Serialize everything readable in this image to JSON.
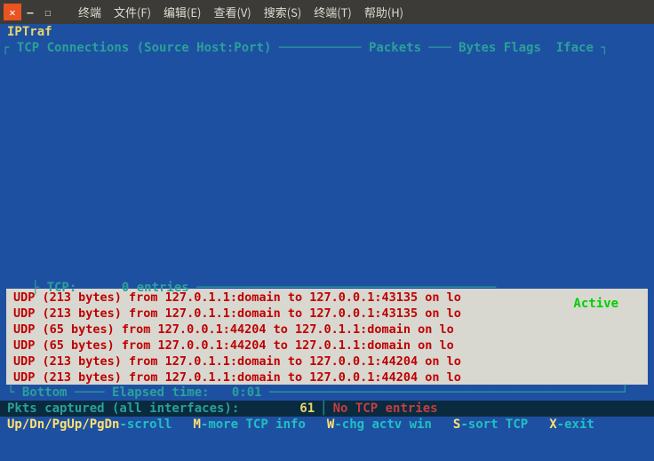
{
  "window": {
    "close": "✕",
    "min": "–",
    "max": "☐"
  },
  "menu": {
    "terminal_app": "终端",
    "file": "文件(F)",
    "edit": "编辑(E)",
    "view": "查看(V)",
    "search": "搜索(S)",
    "terminal": "终端(T)",
    "help": "帮助(H)"
  },
  "app_title": "IPTraf",
  "header": {
    "tcp_conn": "┌ TCP Connections (Source Host:Port) ─────────── Packets ─── Bytes Flags  Iface ┐"
  },
  "tcp_status": {
    "label": "├ TCP:      0 entries ────────────────────────────────────────",
    "active": "Active",
    "tail": " ─┤"
  },
  "udp": [
    "UDP (213 bytes) from 127.0.1.1:domain to 127.0.0.1:43135 on lo",
    "UDP (213 bytes) from 127.0.1.1:domain to 127.0.0.1:43135 on lo",
    "UDP (65 bytes) from 127.0.0.1:44204 to 127.0.1.1:domain on lo",
    "UDP (65 bytes) from 127.0.0.1:44204 to 127.0.1.1:domain on lo",
    "UDP (213 bytes) from 127.0.1.1:domain to 127.0.0.1:44204 on lo",
    "UDP (213 bytes) from 127.0.1.1:domain to 127.0.0.1:44204 on lo"
  ],
  "bottom_line": "└ Bottom ──── Elapsed time:   0:01 ───────────────────────────────────────────────┘",
  "status": {
    "captured": "Pkts captured (all interfaces):",
    "count": "61",
    "sep": "│",
    "tcp": "No TCP entries"
  },
  "help": {
    "k1": "Up/Dn/PgUp/PgDn",
    "a1": "-scroll",
    "k2": "M",
    "a2": "-more TCP info",
    "k3": "W",
    "a3": "-chg actv win",
    "k4": "S",
    "a4": "-sort TCP",
    "k5": "X",
    "a5": "-exit"
  }
}
